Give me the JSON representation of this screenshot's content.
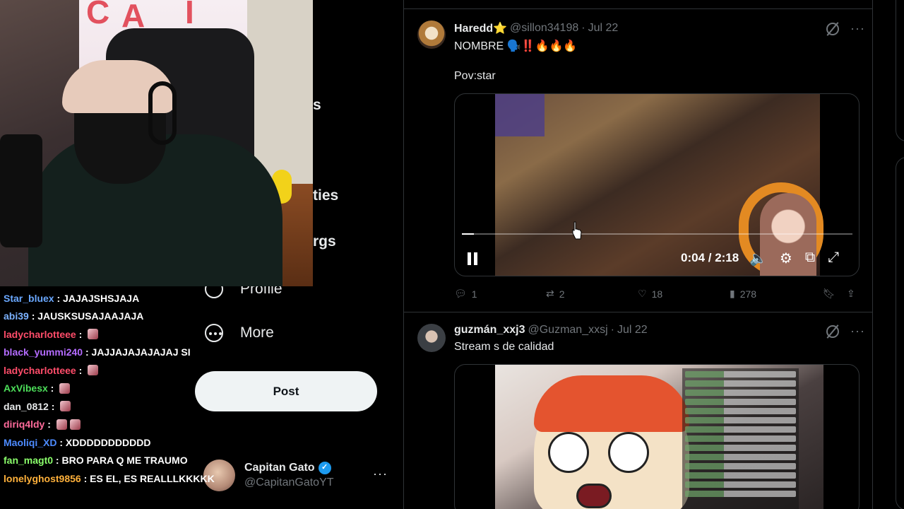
{
  "nav": {
    "fragments": [
      "s",
      "ties",
      "rgs"
    ],
    "profile_label": "Profile",
    "more_label": "More",
    "post_label": "Post"
  },
  "account": {
    "name": "Capitan Gato",
    "handle": "@CapitanGatoYT",
    "more": "···"
  },
  "chat": [
    {
      "user": "Star_bluex",
      "color": "#6aa8ff",
      "text": "JAJAJSHSJAJA",
      "emotes": 0
    },
    {
      "user": "abi39",
      "color": "#7cb2ff",
      "text": "JAUSKSUSAJAAJAJA",
      "emotes": 0
    },
    {
      "user": "ladycharlotteee",
      "color": "#ff4d6a",
      "text": "",
      "emotes": 1
    },
    {
      "user": "black_yummi240",
      "color": "#b46bff",
      "text": "JAJJAJAJAJAJAJ SI",
      "emotes": 0
    },
    {
      "user": "ladycharlotteee",
      "color": "#ff4d6a",
      "text": "",
      "emotes": 1
    },
    {
      "user": "AxVibesx",
      "color": "#4ddf5a",
      "text": "",
      "emotes": 1
    },
    {
      "user": "dan_0812",
      "color": "#e7e9ea",
      "text": "",
      "emotes": 1
    },
    {
      "user": "diriq4ldy",
      "color": "#ff6b9b",
      "text": "",
      "emotes": 2
    },
    {
      "user": "Maoliqi_XD",
      "color": "#4d8bff",
      "text": "XDDDDDDDDDDD",
      "emotes": 0
    },
    {
      "user": "fan_magt0",
      "color": "#8bff6b",
      "text": "BRO PARA Q ME TRAUMO",
      "emotes": 0
    },
    {
      "user": "lonelyghost9856",
      "color": "#ffb13b",
      "text": "ES EL, ES REALLLKKKKK",
      "emotes": 0
    }
  ],
  "tweets": [
    {
      "name": "Haredd⭐",
      "handle": "@sillon34198",
      "date": "Jul 22",
      "line1": "NOMBRE 🗣️‼️🔥🔥🔥",
      "line2": "Pov:star",
      "video": {
        "time": "0:04 / 2:18",
        "progress": 0.03
      },
      "replies": "1",
      "reposts": "2",
      "likes": "18",
      "views": "278"
    },
    {
      "name": "guzmán_xxj3",
      "handle": "@Guzman_xxsj",
      "date": "Jul 22",
      "line1": "Stream s de calidad"
    }
  ],
  "icons": {
    "reply": "reply-icon",
    "repost": "repost-icon",
    "like": "heart-icon",
    "views": "bar-chart-icon",
    "bookmark": "bookmark-icon",
    "share": "share-icon",
    "grok": "grok-icon",
    "more": "more-icon"
  },
  "colors": {
    "accent": "#1d9bf0",
    "text": "#e7e9ea",
    "muted": "#71767b",
    "border": "#2f3336"
  }
}
